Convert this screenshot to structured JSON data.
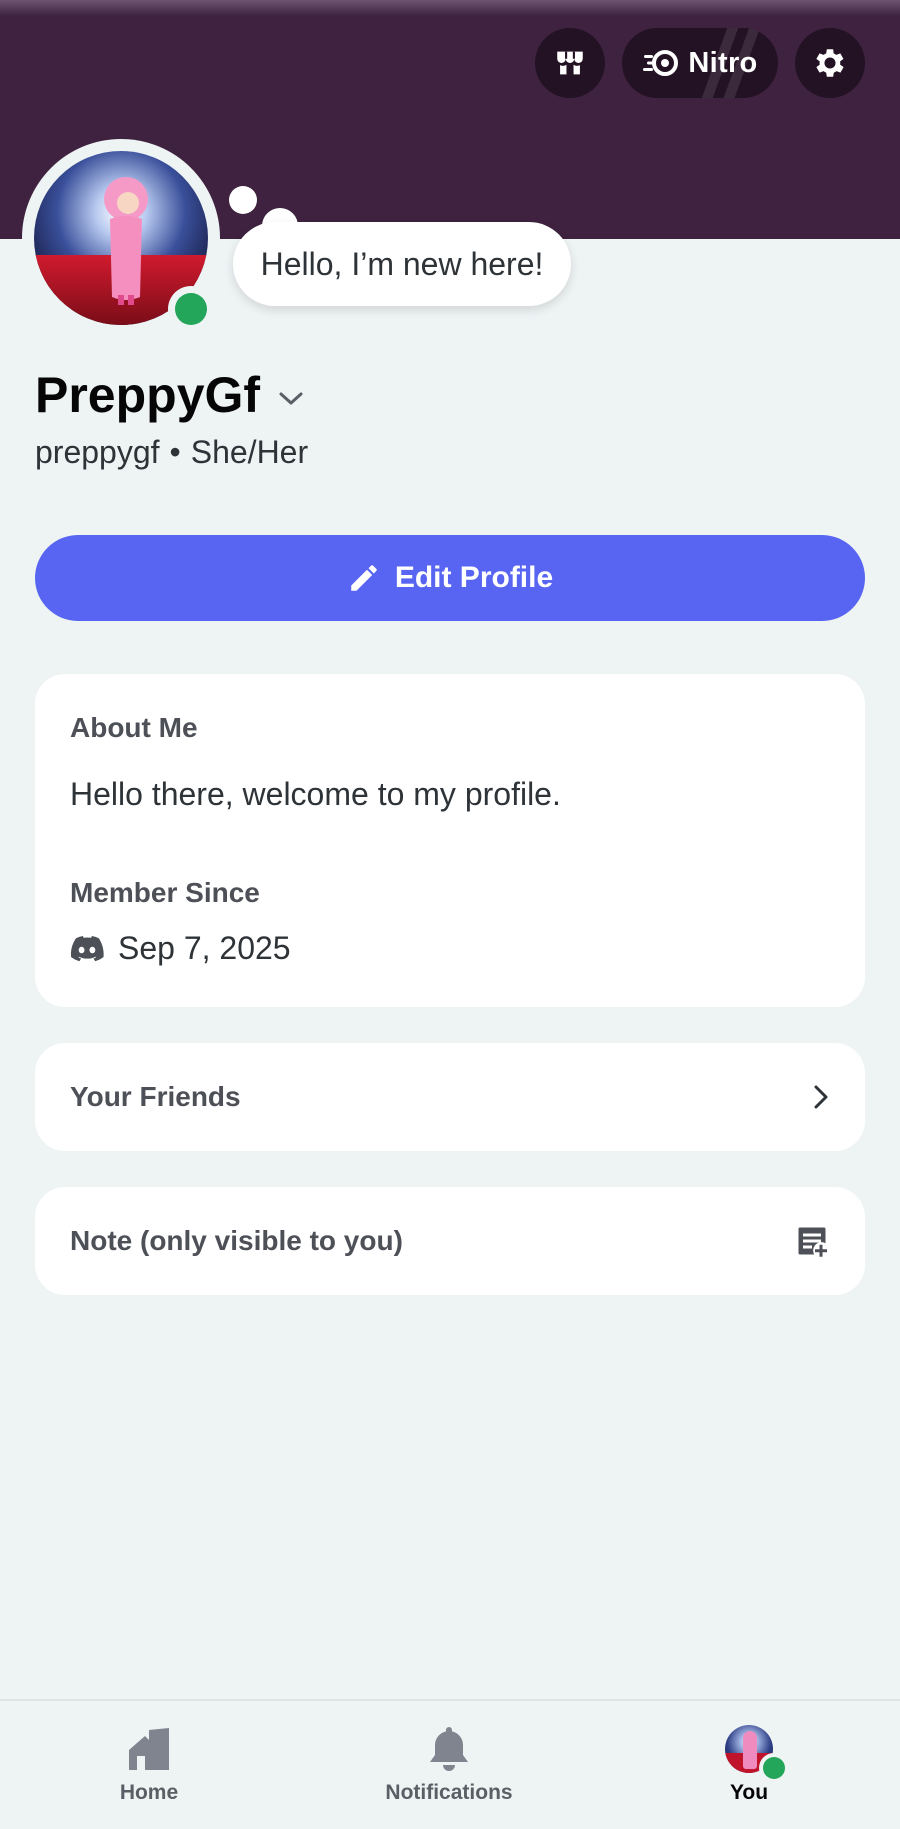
{
  "header": {
    "nitro_label": "Nitro",
    "shop_icon": "shop-icon",
    "nitro_icon": "nitro-icon",
    "settings_icon": "gear-icon",
    "banner_color": "#3e223f"
  },
  "profile": {
    "custom_status": "Hello, I’m new here!",
    "display_name": "PreppyGf",
    "username": "preppygf",
    "separator": "•",
    "pronouns": "She/Her",
    "status": "online",
    "status_color": "#23a55a"
  },
  "edit_profile": {
    "label": "Edit Profile",
    "color": "#5865f2"
  },
  "about": {
    "heading": "About Me",
    "text": "Hello there, welcome to my profile.",
    "member_since_heading": "Member Since",
    "member_since_date": "Sep 7, 2025"
  },
  "friends": {
    "label": "Your Friends"
  },
  "note": {
    "label": "Note (only visible to you)"
  },
  "bottom_nav": {
    "items": [
      {
        "label": "Home",
        "icon": "home-icon",
        "active": false
      },
      {
        "label": "Notifications",
        "icon": "bell-icon",
        "active": false
      },
      {
        "label": "You",
        "icon": "avatar",
        "active": true
      }
    ]
  }
}
